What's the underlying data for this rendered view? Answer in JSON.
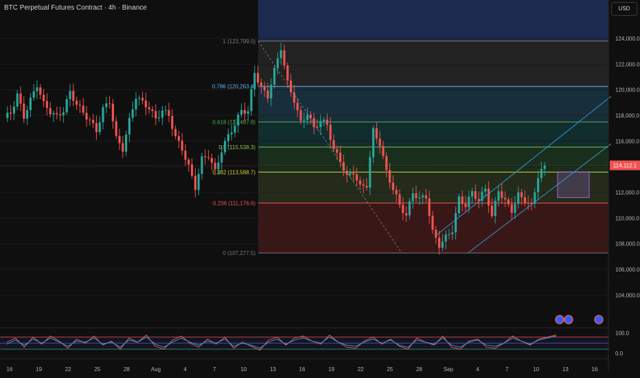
{
  "header": {
    "title": "BTC Perpetual Futures Contract · 4h · Binance",
    "currency": "USD"
  },
  "colors": {
    "background": "#0f0f0f",
    "up": "#26a69a",
    "down": "#ef5350",
    "fib_top": "#1e2f5c",
    "fib_786": "#2a2a2a",
    "fib_618": "#1c3a4a",
    "fib_5": "#14383a",
    "fib_382": "#1d3a22",
    "fib_236": "#2c3620",
    "fib_0": "#4a1b1b",
    "price_badge": "#ef5350",
    "channel": "#2e9bd6",
    "box": "#9c6bd6"
  },
  "chart_data": [
    {
      "type": "candlestick",
      "title": "BTC Perpetual Futures Contract · 4h · Binance",
      "ylim": [
        101500,
        127000
      ],
      "y_ticks": [
        "124,000.0",
        "122,000.0",
        "120,000.0",
        "118,000.0",
        "116,000.0",
        "114,000.0",
        "112,000.0",
        "110,000.0",
        "108,000.0",
        "106,000.0",
        "104,000.0"
      ],
      "y_tick_values": [
        124000,
        122000,
        120000,
        118000,
        116000,
        114000,
        112000,
        110000,
        108000,
        106000,
        104000
      ],
      "x_ticks": [
        "16",
        "19",
        "22",
        "25",
        "28",
        "Aug",
        "4",
        "7",
        "10",
        "13",
        "16",
        "19",
        "22",
        "25",
        "28",
        "Sep",
        "4",
        "7",
        "10",
        "13",
        "16"
      ],
      "last_price": "114,112.1",
      "last_price_value": 114112.1,
      "price_path": [
        [
          0,
          117800
        ],
        [
          2,
          118200
        ],
        [
          4,
          119600
        ],
        [
          6,
          117900
        ],
        [
          8,
          119200
        ],
        [
          10,
          120400
        ],
        [
          12,
          118900
        ],
        [
          14,
          118300
        ],
        [
          16,
          117900
        ],
        [
          18,
          118400
        ],
        [
          20,
          119800
        ],
        [
          22,
          118900
        ],
        [
          24,
          118200
        ],
        [
          26,
          117600
        ],
        [
          28,
          116800
        ],
        [
          30,
          118500
        ],
        [
          32,
          119100
        ],
        [
          34,
          116200
        ],
        [
          36,
          115400
        ],
        [
          38,
          117600
        ],
        [
          40,
          119500
        ],
        [
          42,
          119000
        ],
        [
          44,
          118600
        ],
        [
          46,
          117700
        ],
        [
          48,
          118400
        ],
        [
          50,
          118000
        ],
        [
          52,
          116300
        ],
        [
          54,
          115400
        ],
        [
          56,
          114000
        ],
        [
          58,
          112400
        ],
        [
          60,
          114600
        ],
        [
          62,
          114900
        ],
        [
          64,
          113600
        ],
        [
          66,
          115300
        ],
        [
          68,
          116400
        ],
        [
          70,
          117300
        ],
        [
          72,
          118400
        ],
        [
          74,
          118300
        ],
        [
          76,
          121400
        ],
        [
          78,
          120100
        ],
        [
          80,
          119500
        ],
        [
          82,
          121500
        ],
        [
          84,
          123300
        ],
        [
          86,
          120500
        ],
        [
          88,
          119200
        ],
        [
          90,
          117400
        ],
        [
          92,
          118200
        ],
        [
          94,
          117000
        ],
        [
          96,
          117600
        ],
        [
          98,
          117300
        ],
        [
          100,
          115300
        ],
        [
          102,
          114500
        ],
        [
          104,
          113200
        ],
        [
          106,
          113600
        ],
        [
          108,
          112400
        ],
        [
          110,
          112600
        ],
        [
          112,
          116800
        ],
        [
          114,
          115800
        ],
        [
          116,
          113600
        ],
        [
          118,
          112300
        ],
        [
          120,
          111000
        ],
        [
          122,
          110200
        ],
        [
          124,
          112000
        ],
        [
          126,
          111500
        ],
        [
          128,
          111700
        ],
        [
          130,
          108900
        ],
        [
          132,
          107900
        ],
        [
          134,
          108500
        ],
        [
          136,
          109100
        ],
        [
          138,
          111500
        ],
        [
          140,
          111000
        ],
        [
          142,
          112000
        ],
        [
          144,
          111400
        ],
        [
          146,
          112300
        ],
        [
          148,
          110100
        ],
        [
          150,
          112200
        ],
        [
          152,
          111300
        ],
        [
          154,
          110600
        ],
        [
          156,
          111800
        ],
        [
          158,
          111400
        ],
        [
          160,
          110900
        ],
        [
          162,
          113300
        ],
        [
          164,
          114100
        ]
      ],
      "fib_levels": [
        {
          "ratio": "1",
          "value": 123799.0,
          "label": "1 (123,799.0)",
          "color": "#787b86"
        },
        {
          "ratio": "0.786",
          "value": 120263.4,
          "label": "0.786 (120,263.4)",
          "color": "#64b5f6"
        },
        {
          "ratio": "0.618",
          "value": 117487.8,
          "label": "0.618 (117,487.8)",
          "color": "#4caf50"
        },
        {
          "ratio": "0.5",
          "value": 115538.3,
          "label": "0.5 (115,538.3)",
          "color": "#8bc34a"
        },
        {
          "ratio": "0.382",
          "value": 113588.7,
          "label": "0.382 (113,588.7)",
          "color": "#cddc39"
        },
        {
          "ratio": "0.236",
          "value": 111176.6,
          "label": "0.236 (111,176.6)",
          "color": "#ef5350"
        },
        {
          "ratio": "0",
          "value": 107277.5,
          "label": "0 (107,277.5)",
          "color": "#787b86"
        }
      ]
    },
    {
      "type": "line",
      "title": "",
      "y_ticks": [
        "100.0",
        "0.0"
      ],
      "y_tick_values": [
        100,
        0
      ],
      "ylim": [
        -20,
        115
      ],
      "bands": [
        80,
        50,
        20
      ],
      "series": [
        {
          "color": "#ef5350",
          "values": [
            55,
            75,
            30,
            80,
            45,
            85,
            60,
            25,
            70,
            50,
            85,
            40,
            60,
            20,
            75,
            55,
            90,
            35,
            20,
            65,
            85,
            50,
            30,
            70,
            45,
            80,
            25,
            55,
            35,
            15,
            65,
            80,
            40,
            75,
            85,
            60,
            45,
            90,
            55,
            30,
            25,
            60,
            80,
            45,
            70,
            35,
            20,
            75,
            55,
            40,
            85,
            30,
            20,
            60,
            70,
            30,
            25,
            50,
            85,
            60,
            40,
            70,
            80,
            90
          ]
        },
        {
          "color": "#2e9bd6",
          "values": [
            45,
            65,
            40,
            70,
            50,
            75,
            55,
            35,
            60,
            55,
            75,
            45,
            55,
            30,
            65,
            55,
            80,
            45,
            30,
            55,
            75,
            55,
            40,
            60,
            50,
            70,
            35,
            50,
            40,
            25,
            55,
            70,
            45,
            65,
            75,
            60,
            50,
            80,
            55,
            40,
            35,
            55,
            70,
            50,
            65,
            40,
            30,
            65,
            55,
            45,
            75,
            40,
            30,
            55,
            65,
            40,
            35,
            50,
            75,
            60,
            45,
            65,
            75,
            85
          ]
        }
      ]
    }
  ]
}
